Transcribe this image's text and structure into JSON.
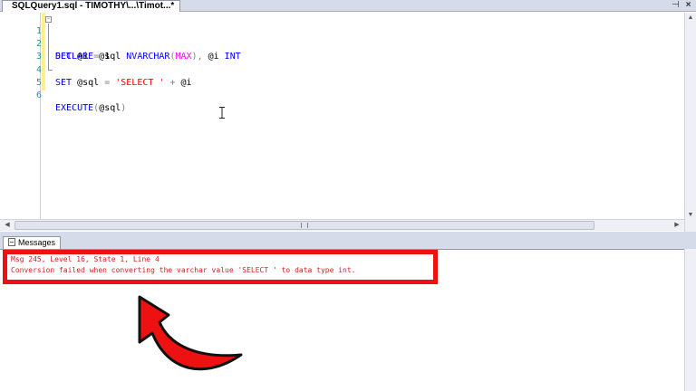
{
  "window": {
    "tab_title": "SQLQuery1.sql - TIMOTHY\\...\\Timot...*",
    "pin_symbol": "⊣",
    "close_symbol": "×"
  },
  "editor": {
    "lines": [
      {
        "number": "1",
        "tokens": [
          {
            "text": "DECLARE",
            "kind": "kw"
          },
          {
            "text": " @sql ",
            "kind": "plain"
          },
          {
            "text": "NVARCHAR",
            "kind": "kw"
          },
          {
            "text": "(",
            "kind": "gray"
          },
          {
            "text": "MAX",
            "kind": "fn"
          },
          {
            "text": "), ",
            "kind": "gray"
          },
          {
            "text": "@i ",
            "kind": "plain"
          },
          {
            "text": "INT",
            "kind": "kw"
          }
        ]
      },
      {
        "number": "2",
        "tokens": [
          {
            "text": "SET",
            "kind": "kw"
          },
          {
            "text": " @i ",
            "kind": "plain"
          },
          {
            "text": "=",
            "kind": "gray"
          },
          {
            "text": " 1",
            "kind": "plain"
          }
        ]
      },
      {
        "number": "3",
        "tokens": []
      },
      {
        "number": "4",
        "tokens": [
          {
            "text": "SET",
            "kind": "kw"
          },
          {
            "text": " @sql ",
            "kind": "plain"
          },
          {
            "text": "=",
            "kind": "gray"
          },
          {
            "text": " ",
            "kind": "plain"
          },
          {
            "text": "'SELECT '",
            "kind": "str"
          },
          {
            "text": " ",
            "kind": "plain"
          },
          {
            "text": "+",
            "kind": "gray"
          },
          {
            "text": " @i",
            "kind": "plain"
          }
        ]
      },
      {
        "number": "5",
        "tokens": []
      },
      {
        "number": "6",
        "tokens": [
          {
            "text": "EXECUTE",
            "kind": "kw"
          },
          {
            "text": "(",
            "kind": "gray"
          },
          {
            "text": "@sql",
            "kind": "plain"
          },
          {
            "text": ")",
            "kind": "gray"
          }
        ]
      }
    ],
    "fold_symbol": "-"
  },
  "results": {
    "tab_label": "Messages",
    "messages": [
      "Msg 245, Level 16, State 1, Line 4",
      "Conversion failed when converting the varchar value 'SELECT ' to data type int."
    ]
  },
  "scroll_arrows": {
    "up": "▲",
    "down": "▼",
    "left": "◀",
    "right": "▶"
  },
  "colors": {
    "keyword": "#0000ff",
    "function": "#ff00ff",
    "string": "#ff0000",
    "operator": "#808080",
    "line_number": "#2b91af",
    "error_text": "#cc2222",
    "annotation": "#ee1111"
  }
}
